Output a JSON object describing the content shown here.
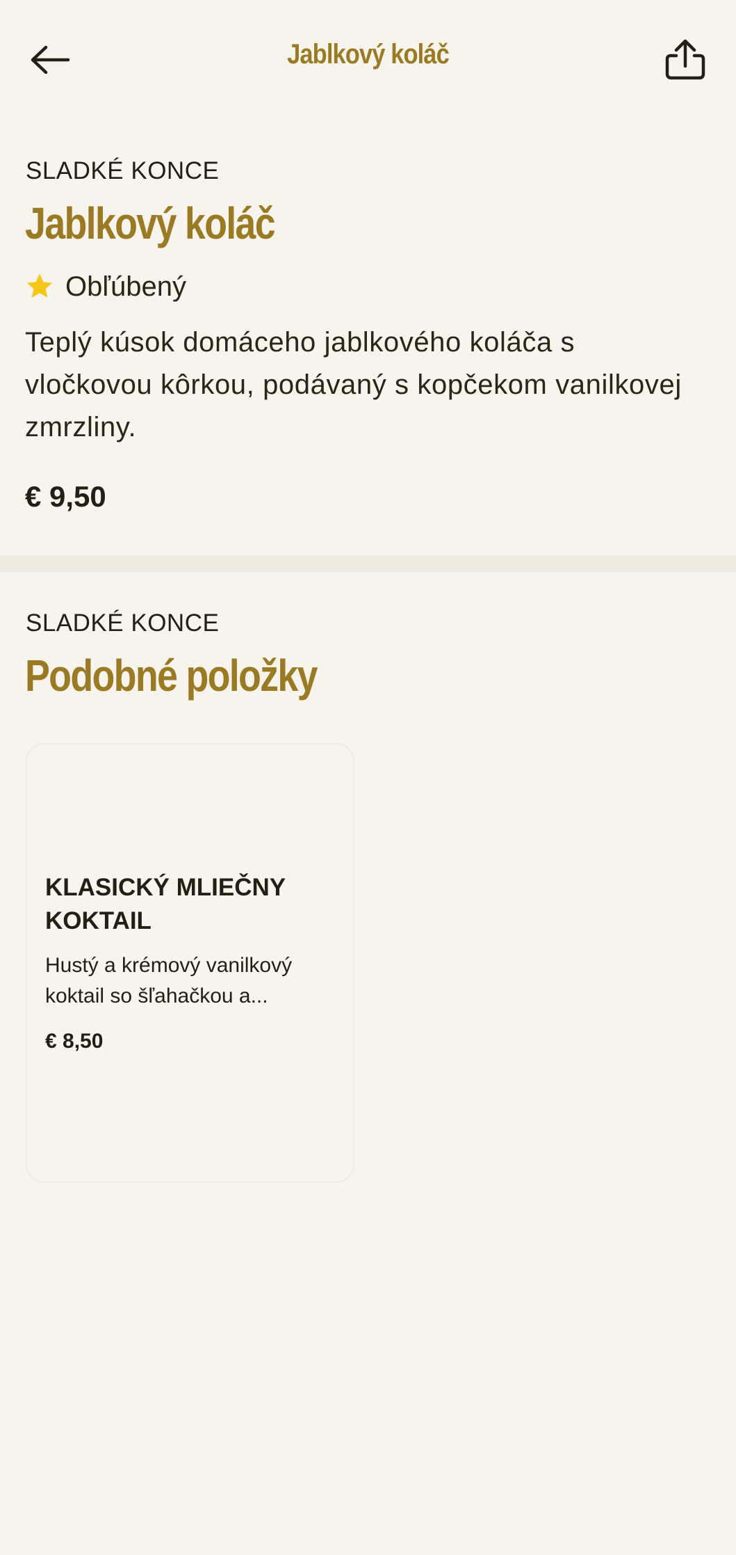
{
  "header": {
    "title": "Jablkový koláč",
    "back_icon": "arrow-left-icon",
    "share_icon": "share-icon"
  },
  "item": {
    "category": "SLADKÉ KONCE",
    "name": "Jablkový koláč",
    "badge": {
      "icon": "star-icon",
      "label": "Obľúbený"
    },
    "description": "Teplý kúsok domáceho jablkového koláča s vločkovou kôrkou, podávaný s kopčekom vanilkovej zmrzliny.",
    "price": "€ 9,50"
  },
  "similar": {
    "category": "SLADKÉ KONCE",
    "heading": "Podobné položky",
    "items": [
      {
        "name": "KLASICKÝ MLIEČNY KOKTAIL",
        "description": "Hustý a krémový vanilkový koktail so šľahačkou a...",
        "price": "€ 8,50"
      }
    ]
  },
  "colors": {
    "background": "#f7f4ee",
    "accent": "#9a7a22",
    "text": "#221f14",
    "star": "#f5c518",
    "divider": "#efebe2"
  }
}
